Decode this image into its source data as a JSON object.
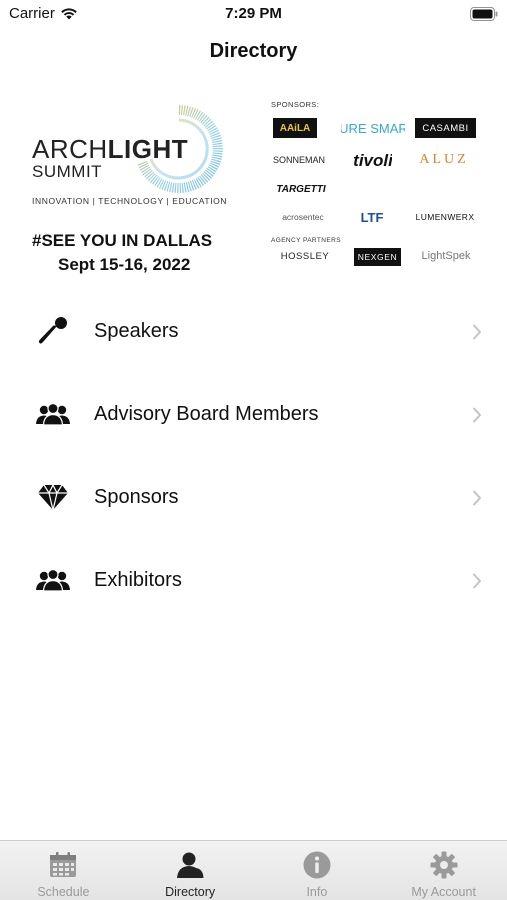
{
  "status_bar": {
    "carrier": "Carrier",
    "time": "7:29 PM",
    "icons": [
      "wifi-icon",
      "battery-icon"
    ]
  },
  "nav": {
    "title": "Directory"
  },
  "banner": {
    "brand_part1": "ARCH",
    "brand_part2": "LIGHT",
    "brand_line2": "SUMMIT",
    "tagline": "INNOVATION | TECHNOLOGY | EDUCATION",
    "hashtag": "#SEE YOU IN DALLAS",
    "date": "Sept 15-16, 2022",
    "sponsors_heading": "SPONSORS:",
    "sponsors": [
      "AAiLA",
      "PURE SMART",
      "CASAMBI",
      "SONNEMAN",
      "tivoli",
      "ALUZ",
      "TARGETTI",
      "acrosentec",
      "LTF",
      "LUMENWERX"
    ],
    "agency_heading": "AGENCY PARTNERS",
    "agency_partners": [
      "HOSSLEY",
      "NEXGEN",
      "LightSpek"
    ]
  },
  "menu": [
    {
      "label": "Speakers",
      "icon": "microphone-icon"
    },
    {
      "label": "Advisory Board Members",
      "icon": "group-icon"
    },
    {
      "label": "Sponsors",
      "icon": "diamond-icon"
    },
    {
      "label": "Exhibitors",
      "icon": "group-icon"
    }
  ],
  "tabs": [
    {
      "label": "Schedule",
      "icon": "calendar-icon",
      "active": false
    },
    {
      "label": "Directory",
      "icon": "person-icon",
      "active": true
    },
    {
      "label": "Info",
      "icon": "info-icon",
      "active": false
    },
    {
      "label": "My Account",
      "icon": "gear-icon",
      "active": false
    }
  ],
  "colors": {
    "active_tab": "#222222",
    "inactive_tab": "#9a9a9a",
    "chevron": "#c4c4c4",
    "icon": "#111111"
  }
}
